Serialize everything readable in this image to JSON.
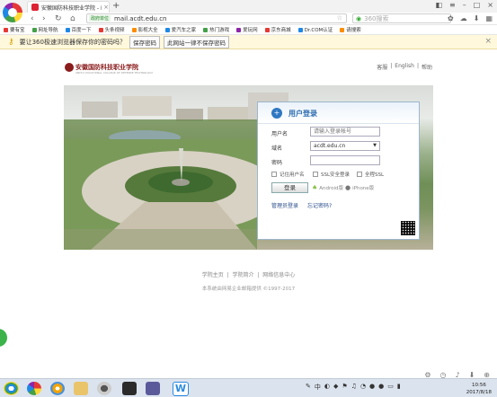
{
  "browser": {
    "tab_title": "安徽国防科技职业学院 - 邮件...",
    "tab_close": "×",
    "new_tab": "+",
    "address_security": "政府单位",
    "address_url": "mail.acdt.edu.cn",
    "search_placeholder": "360搜索",
    "nav": {
      "back": "‹",
      "forward": "›",
      "refresh": "↻",
      "home": "⌂"
    }
  },
  "bookmarks": [
    {
      "label": "要有宝",
      "color": "#e53935"
    },
    {
      "label": "网址导航",
      "color": "#43a047"
    },
    {
      "label": "百度一下",
      "color": "#1e88e5"
    },
    {
      "label": "头条视频",
      "color": "#e53935"
    },
    {
      "label": "影视大全",
      "color": "#fb8c00"
    },
    {
      "label": "爱汽车之家",
      "color": "#1e88e5"
    },
    {
      "label": "热门游戏",
      "color": "#43a047"
    },
    {
      "label": "爱玩网",
      "color": "#8e24aa"
    },
    {
      "label": "京东商城",
      "color": "#e53935"
    },
    {
      "label": "Dr.COM认证",
      "color": "#1e88e5"
    },
    {
      "label": "请搜索",
      "color": "#fb8c00"
    }
  ],
  "password_bar": {
    "message": "要让360极速浏览器保存你的密码吗？",
    "save_button": "保存密码",
    "never_button": "此网站一律不保存密码",
    "close": "×"
  },
  "site": {
    "logo_text": "安徽国防科技职业学院",
    "logo_sub": "ANHUI VOCATIONAL COLLEGE OF DEFENSE TECHNOLOGY",
    "top_links": [
      "客服",
      "English",
      "帮助"
    ],
    "top_sep": "|"
  },
  "login": {
    "heading": "用户登录",
    "username_label": "用户名",
    "username_placeholder": "请输入登录帐号",
    "domain_label": "域名",
    "domain_value": "acdt.edu.cn",
    "password_label": "密码",
    "remember_label": "记住用户名",
    "ssl_label": "SSL安全登录",
    "full_ssl_label": "全程SSL",
    "submit": "登录",
    "android": "Android版",
    "iphone": "iPhone版",
    "admin_link": "管理员登录",
    "forgot_link": "忘记密码?"
  },
  "footer": {
    "links": [
      "学院主页",
      "学院简介",
      "网络信息中心"
    ],
    "sep": "|",
    "copyright": "本系统由网易企业邮箱提供 ©1997-2017"
  },
  "taskbar": {
    "time": "10:56",
    "date": "2017/8/18",
    "lang": "中"
  }
}
